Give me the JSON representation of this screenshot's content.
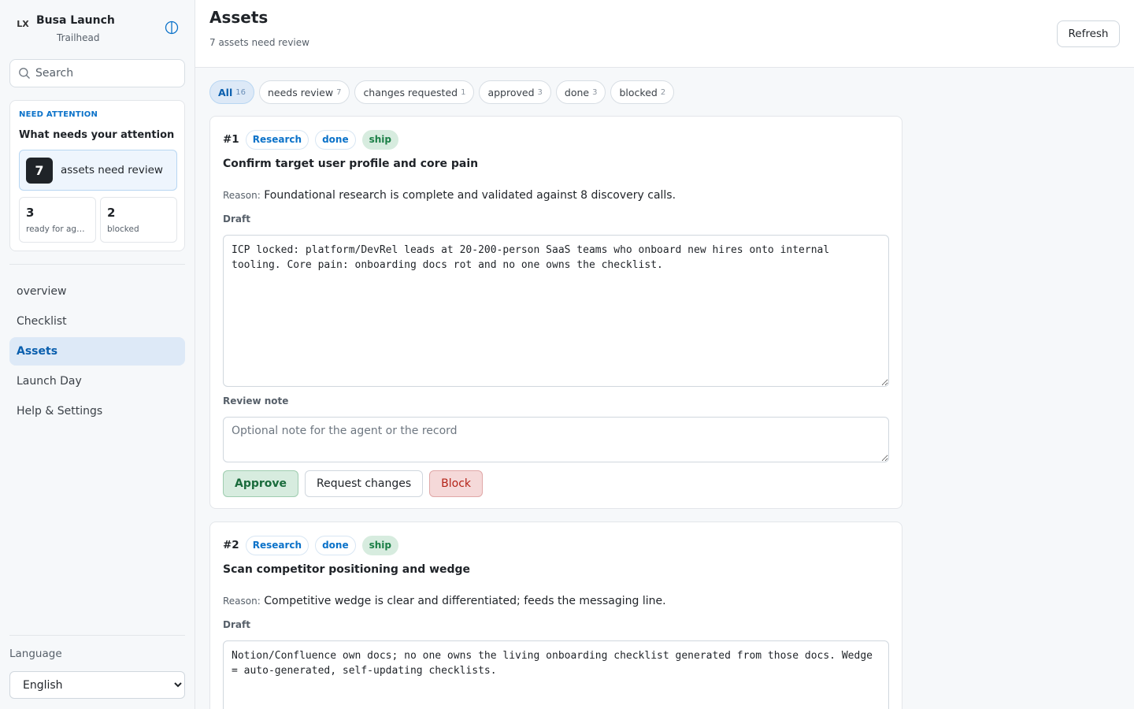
{
  "brand": {
    "logo": "LX",
    "name": "Busa Launch",
    "subtitle": "Trailhead"
  },
  "search": {
    "placeholder": "Search"
  },
  "attention": {
    "eyebrow": "NEED ATTENTION",
    "title": "What needs your attention",
    "review": {
      "count": "7",
      "label": "assets need review"
    },
    "ready": {
      "count": "3",
      "label": "ready for age..."
    },
    "blocked": {
      "count": "2",
      "label": "blocked"
    }
  },
  "nav": [
    {
      "label": "overview"
    },
    {
      "label": "Checklist"
    },
    {
      "label": "Assets",
      "active": true
    },
    {
      "label": "Launch Day"
    },
    {
      "label": "Help & Settings"
    }
  ],
  "language": {
    "label": "Language",
    "selected": "English"
  },
  "header": {
    "title": "Assets",
    "subtitle": "7 assets need review",
    "refresh": "Refresh"
  },
  "filters": [
    {
      "label": "All",
      "count": "16",
      "active": true
    },
    {
      "label": "needs review",
      "count": "7"
    },
    {
      "label": "changes requested",
      "count": "1"
    },
    {
      "label": "approved",
      "count": "3"
    },
    {
      "label": "done",
      "count": "3"
    },
    {
      "label": "blocked",
      "count": "2"
    }
  ],
  "labels": {
    "reason": "Reason:",
    "draft": "Draft",
    "review_note": "Review note",
    "note_placeholder": "Optional note for the agent or the record",
    "approve": "Approve",
    "request_changes": "Request changes",
    "block": "Block"
  },
  "cards": [
    {
      "num": "#1",
      "tags": [
        "Research",
        "done",
        "ship"
      ],
      "title": "Confirm target user profile and core pain",
      "reason": "Foundational research is complete and validated against 8 discovery calls.",
      "draft": "ICP locked: platform/DevRel leads at 20-200-person SaaS teams who onboard new hires onto internal tooling. Core pain: onboarding docs rot and no one owns the checklist."
    },
    {
      "num": "#2",
      "tags": [
        "Research",
        "done",
        "ship"
      ],
      "title": "Scan competitor positioning and wedge",
      "reason": "Competitive wedge is clear and differentiated; feeds the messaging line.",
      "draft": "Notion/Confluence own docs; no one owns the living onboarding checklist generated from those docs. Wedge = auto-generated, self-updating checklists."
    }
  ],
  "colors": {
    "accent": "#0b72c9",
    "success": "#1a7f46",
    "danger": "#b42318"
  }
}
